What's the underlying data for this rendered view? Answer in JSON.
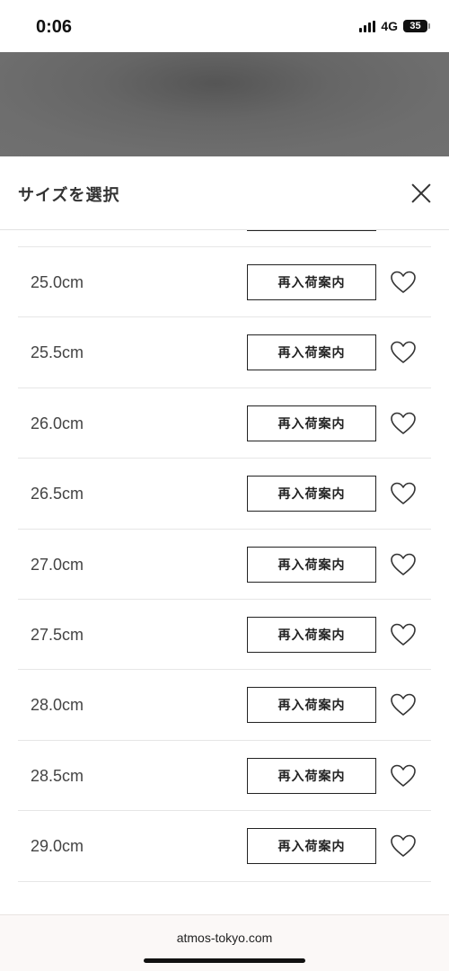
{
  "status_bar": {
    "time": "0:06",
    "network": "4G",
    "battery": "35"
  },
  "sheet": {
    "title": "サイズを選択",
    "rows": [
      {
        "size": "25.0cm",
        "button": "再入荷案内"
      },
      {
        "size": "25.5cm",
        "button": "再入荷案内"
      },
      {
        "size": "26.0cm",
        "button": "再入荷案内"
      },
      {
        "size": "26.5cm",
        "button": "再入荷案内"
      },
      {
        "size": "27.0cm",
        "button": "再入荷案内"
      },
      {
        "size": "27.5cm",
        "button": "再入荷案内"
      },
      {
        "size": "28.0cm",
        "button": "再入荷案内"
      },
      {
        "size": "28.5cm",
        "button": "再入荷案内"
      },
      {
        "size": "29.0cm",
        "button": "再入荷案内"
      }
    ]
  },
  "browser": {
    "url": "atmos-tokyo.com"
  },
  "icons": {
    "close": "close-icon",
    "favorite": "heart-icon",
    "signal": "signal-icon",
    "battery": "battery-icon"
  }
}
